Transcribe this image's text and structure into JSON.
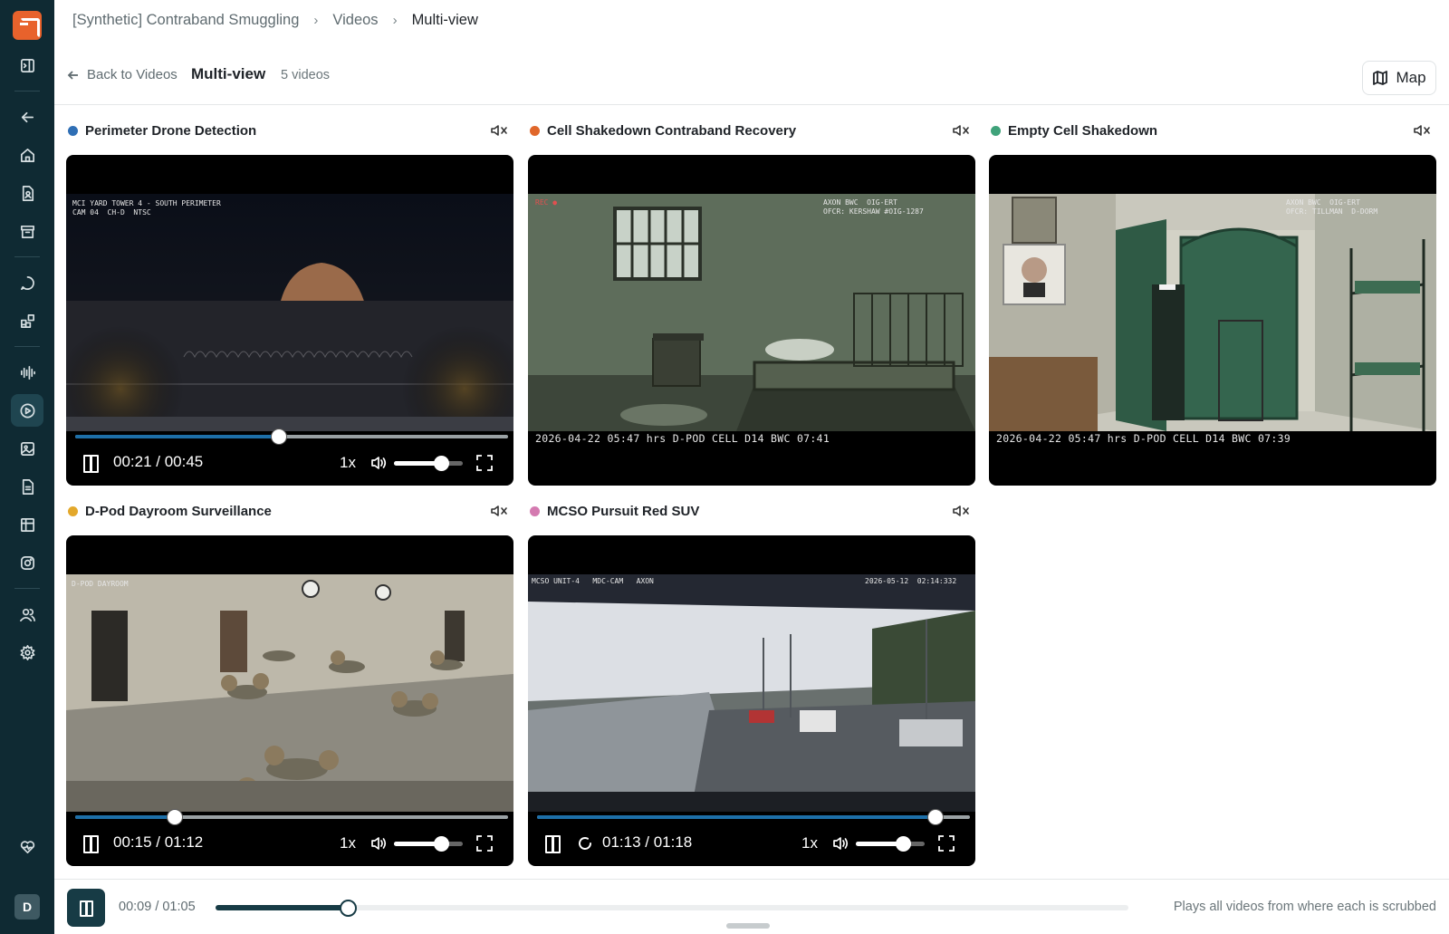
{
  "breadcrumb": {
    "case": "[Synthetic] Contraband Smuggling",
    "section": "Videos",
    "current": "Multi-view"
  },
  "subheader": {
    "back_label": "Back to Videos",
    "title": "Multi-view",
    "count": "5 videos",
    "map_label": "Map"
  },
  "tiles": [
    {
      "title": "Perimeter Drone Detection",
      "color": "#2f6fb5",
      "time": "00:21 / 00:45",
      "rate": "1x",
      "progress": 0.47,
      "volume": 0.68,
      "osd_top": "MCI YARD TOWER 4 - SOUTH PERIMETER\nCAM 04  CH-D  NTSC"
    },
    {
      "title": "Cell Shakedown Contraband Recovery",
      "color": "#e0672a",
      "osd_top_left": "REC ●",
      "osd_top_right": "AXON BWC  OIG-ERT\nOFCR: KERSHAW #OIG-1287",
      "osd_bottom": "2026-04-22   05:47 hrs   D-POD CELL D14   BWC 07:41"
    },
    {
      "title": "Empty Cell Shakedown",
      "color": "#3fa27a",
      "osd_top_right": "AXON BWC  OIG-ERT\nOFCR: TILLMAN  D-DORM",
      "osd_bottom": "2026-04-22   05:47 hrs   D-POD CELL D14   BWC 07:39"
    },
    {
      "title": "D-Pod Dayroom Surveillance",
      "color": "#e3a82b",
      "time": "00:15 / 01:12",
      "rate": "1x",
      "progress": 0.23,
      "volume": 0.68,
      "osd_top": "D-POD DAYROOM"
    },
    {
      "title": "MCSO Pursuit Red SUV",
      "color": "#d47ab0",
      "time": "01:13 / 01:18",
      "rate": "1x",
      "progress": 0.92,
      "volume": 0.68,
      "osd_top_left": "MCSO UNIT-4   MDC-CAM   AXON",
      "osd_top_right": "2026-05-12  02:14:332"
    }
  ],
  "master": {
    "time": "00:09 / 01:05",
    "progress": 0.145,
    "note": "Plays all videos from where each is scrubbed"
  },
  "sidebar": {
    "avatar": "D"
  }
}
